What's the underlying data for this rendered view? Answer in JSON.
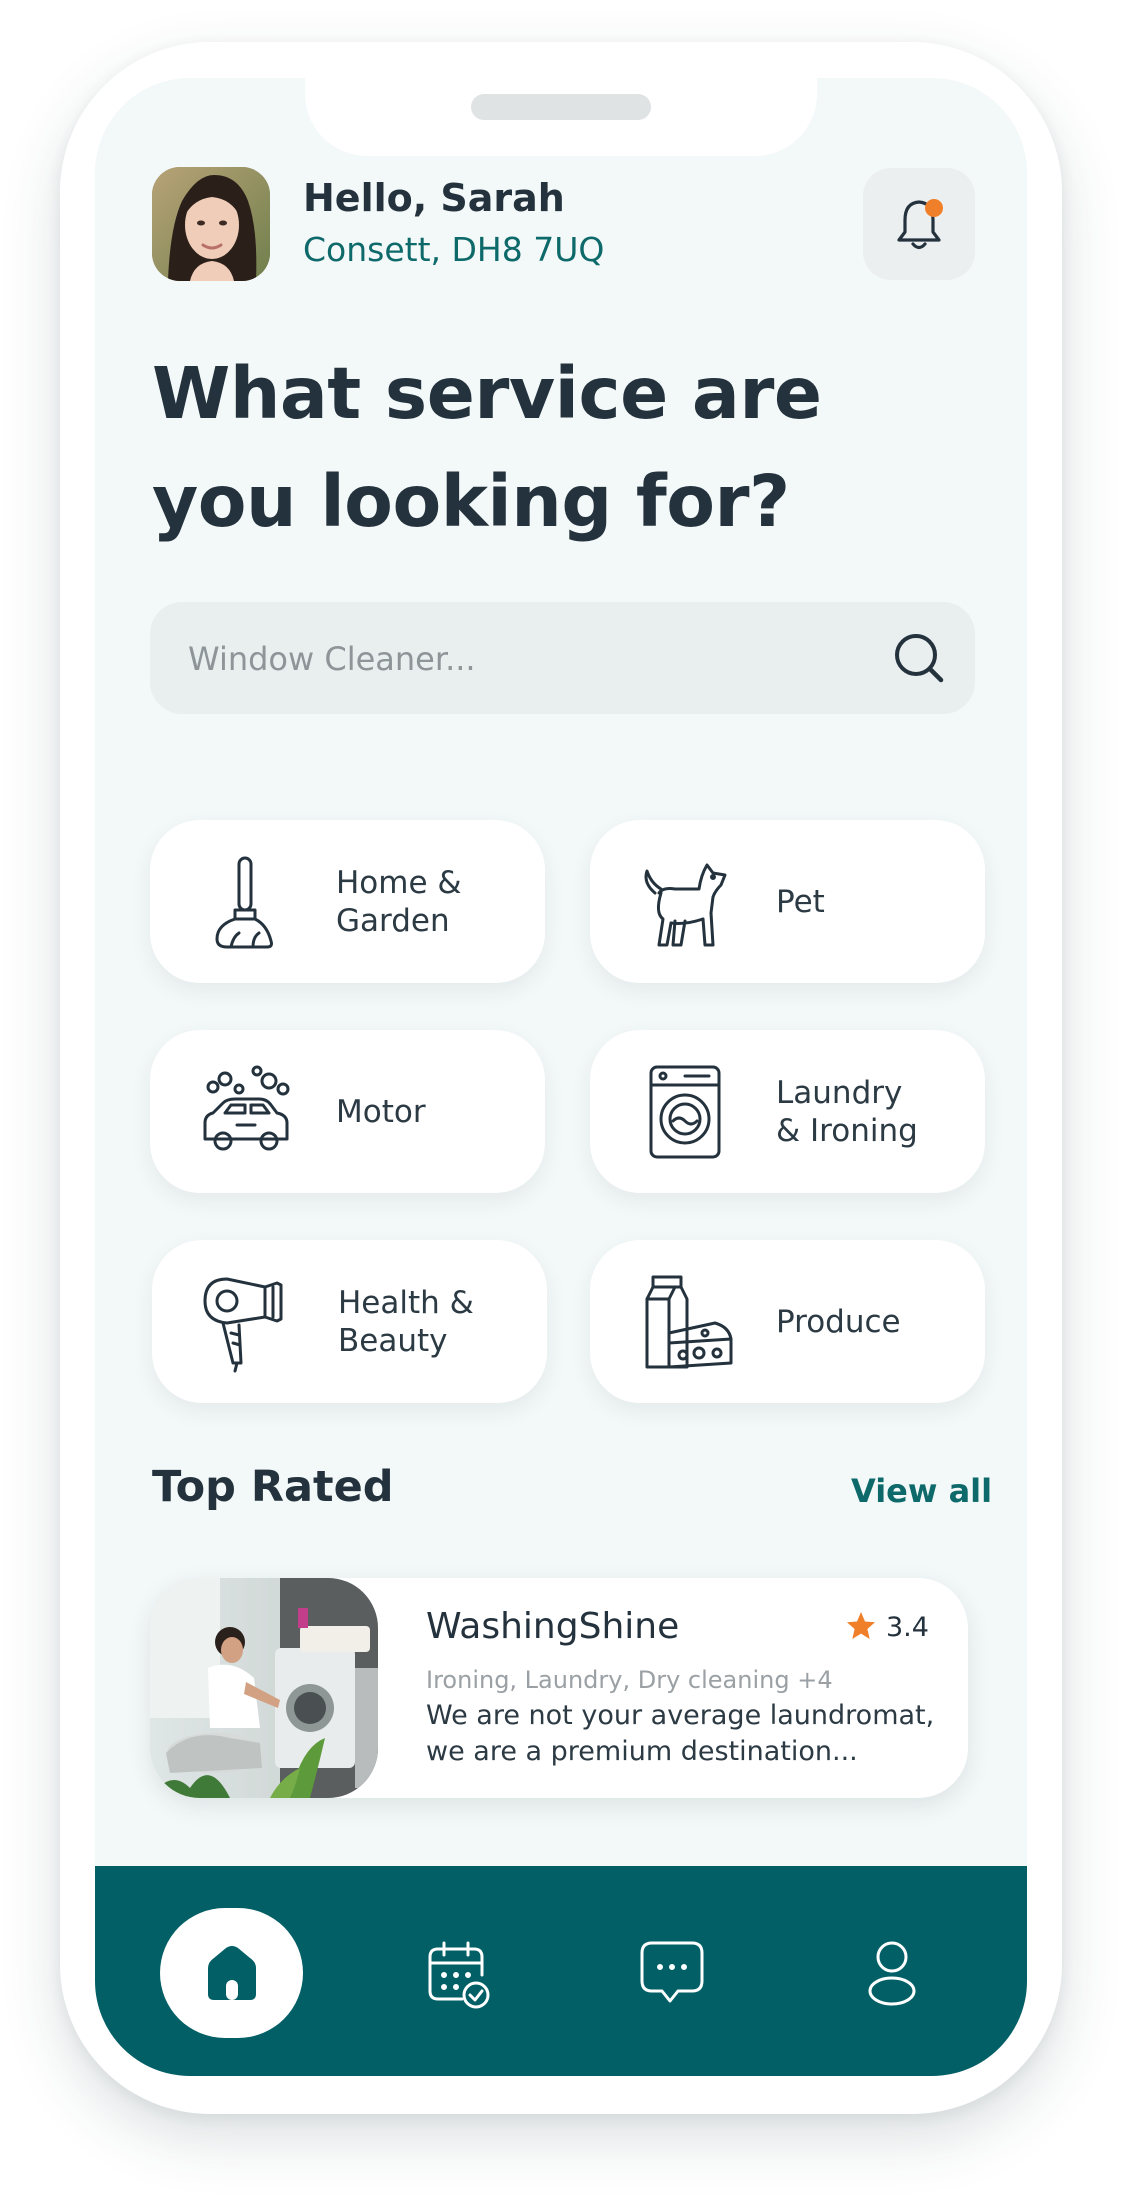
{
  "header": {
    "greeting": "Hello, Sarah",
    "location": "Consett, DH8 7UQ",
    "notification_icon": "bell-icon",
    "notification_indicator": true
  },
  "headline": "What service are you looking for?",
  "search": {
    "placeholder": "Window Cleaner...",
    "value": "",
    "icon": "search-icon"
  },
  "categories": [
    {
      "label": "Home &\nGarden",
      "icon": "mop-icon"
    },
    {
      "label": "Pet",
      "icon": "dog-icon"
    },
    {
      "label": "Motor",
      "icon": "car-wash-icon"
    },
    {
      "label": "Laundry\n& Ironing",
      "icon": "washing-machine-icon"
    },
    {
      "label": "Health &\nBeauty",
      "icon": "hair-dryer-icon"
    },
    {
      "label": "Produce",
      "icon": "milk-cheese-icon"
    }
  ],
  "top_rated": {
    "title": "Top Rated",
    "view_all": "View all",
    "items": [
      {
        "name": "WashingShine",
        "rating": "3.4",
        "tags": "Ironing, Laundry, Dry cleaning +4",
        "description": "We are not your average laundromat, we are a premium destination..."
      }
    ]
  },
  "bottom_nav": {
    "items": [
      {
        "icon": "home-icon",
        "active": true
      },
      {
        "icon": "calendar-check-icon",
        "active": false
      },
      {
        "icon": "chat-icon",
        "active": false
      },
      {
        "icon": "profile-icon",
        "active": false
      }
    ]
  },
  "colors": {
    "accent": "#0e6a6a",
    "navbar": "#025f66",
    "notification_dot": "#f07f2a",
    "star": "#f07f2a",
    "background": "#f3f8f8"
  }
}
